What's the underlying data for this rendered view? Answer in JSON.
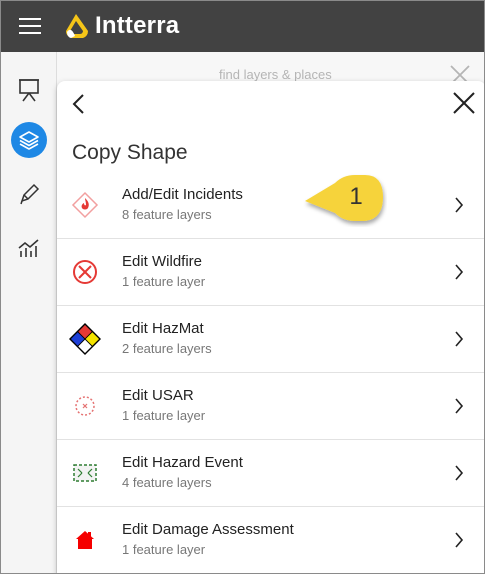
{
  "app": {
    "brand": "Intterra",
    "colors": {
      "topbar": "#424242",
      "accent": "#1e88e5",
      "logo": "#f5c518",
      "callout": "#f6d33a"
    }
  },
  "search": {
    "placeholder": "find layers & places"
  },
  "rail": {
    "items": [
      {
        "name": "presentation-icon",
        "active": false
      },
      {
        "name": "layers-icon",
        "active": true
      },
      {
        "name": "pencil-icon",
        "active": false
      },
      {
        "name": "analytics-icon",
        "active": false
      }
    ]
  },
  "panel": {
    "title": "Copy Shape",
    "items": [
      {
        "label": "Add/Edit Incidents",
        "sub": "8 feature layers",
        "icon": "incident-flame-icon"
      },
      {
        "label": "Edit Wildfire",
        "sub": "1 feature layer",
        "icon": "wildfire-circle-icon"
      },
      {
        "label": "Edit HazMat",
        "sub": "2 feature layers",
        "icon": "hazmat-diamond-icon"
      },
      {
        "label": "Edit USAR",
        "sub": "1 feature layer",
        "icon": "usar-icon"
      },
      {
        "label": "Edit Hazard Event",
        "sub": "4 feature layers",
        "icon": "hazard-event-icon"
      },
      {
        "label": "Edit Damage Assessment",
        "sub": "1 feature layer",
        "icon": "damage-house-icon"
      }
    ]
  },
  "callout": {
    "number": "1"
  }
}
